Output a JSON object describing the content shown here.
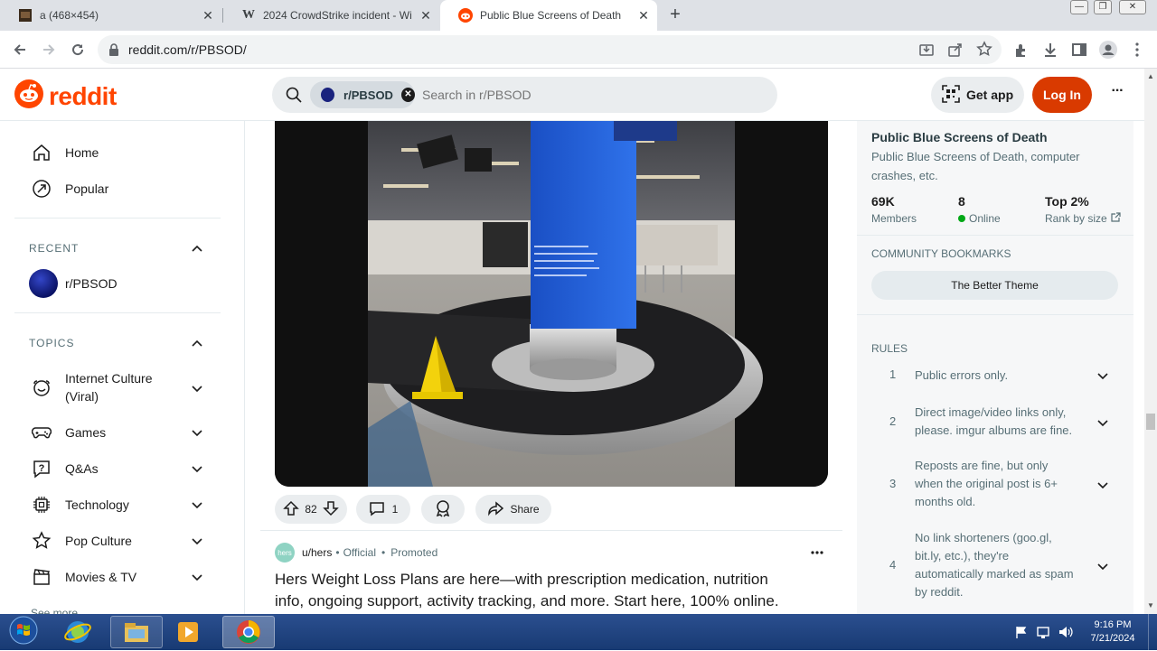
{
  "browser": {
    "tabs": [
      {
        "title": "a (468×454)"
      },
      {
        "title": "2024 CrowdStrike incident - Wi"
      },
      {
        "title": "Public Blue Screens of Death"
      }
    ],
    "new_tab_label": "+",
    "url": "reddit.com/r/PBSOD/"
  },
  "header": {
    "logo_text": "reddit",
    "search_chip": "r/PBSOD",
    "search_placeholder": "Search in r/PBSOD",
    "get_app": "Get app",
    "login": "Log In",
    "more": "···"
  },
  "leftnav": {
    "home": "Home",
    "popular": "Popular",
    "recent_label": "RECENT",
    "recent_item": "r/PBSOD",
    "topics_label": "TOPICS",
    "topics": [
      {
        "label": "Internet Culture (Viral)",
        "line1": "Internet Culture",
        "line2": "(Viral)",
        "icon": "smile-icon"
      },
      {
        "label": "Games",
        "icon": "gamepad-icon"
      },
      {
        "label": "Q&As",
        "icon": "question-icon"
      },
      {
        "label": "Technology",
        "icon": "chip-icon"
      },
      {
        "label": "Pop Culture",
        "icon": "star-icon"
      },
      {
        "label": "Movies & TV",
        "icon": "clapper-icon"
      }
    ],
    "see_more": "See more"
  },
  "post": {
    "upvotes": "82",
    "comments": "1",
    "share": "Share"
  },
  "promoted": {
    "author": "u/hers",
    "official": "Official",
    "promoted": "Promoted",
    "avatar_text": "hers",
    "title": "Hers Weight Loss Plans are here—with prescription medication, nutrition info, ongoing support, activity tracking, and more. Start here, 100% online.",
    "title_line1": "Hers Weight Loss Plans are here—with prescription medication, nutrition",
    "title_line2": "info, ongoing support, activity tracking, and more. Start here, 100% online."
  },
  "community": {
    "name": "Public Blue Screens of Death",
    "description": "Public Blue Screens of Death, computer crashes, etc.",
    "desc_line1": "Public Blue Screens of Death, computer",
    "desc_line2": "crashes, etc.",
    "members_value": "69K",
    "members_label": "Members",
    "online_value": "8",
    "online_label": "Online",
    "rank_value": "Top 2%",
    "rank_label": "Rank by size",
    "bookmarks_label": "COMMUNITY BOOKMARKS",
    "bookmark_button": "The Better Theme",
    "rules_label": "RULES",
    "rules": [
      {
        "num": "1",
        "lines": [
          "Public errors only."
        ]
      },
      {
        "num": "2",
        "lines": [
          "Direct image/video links only,",
          "please. imgur albums are fine."
        ]
      },
      {
        "num": "3",
        "lines": [
          "Reposts are fine, but only",
          "when the original post is 6+",
          "months old."
        ]
      },
      {
        "num": "4",
        "lines": [
          "No link shorteners (goo.gl,",
          "bit.ly, etc.), they're",
          "automatically marked as spam",
          "by reddit."
        ]
      }
    ]
  },
  "taskbar": {
    "time": "9:16 PM",
    "date": "7/21/2024"
  },
  "colors": {
    "reddit_orange": "#ff4500",
    "login_bg": "#d93a00",
    "online_dot": "#01a816",
    "blue_screen": "#1f5fd6"
  }
}
